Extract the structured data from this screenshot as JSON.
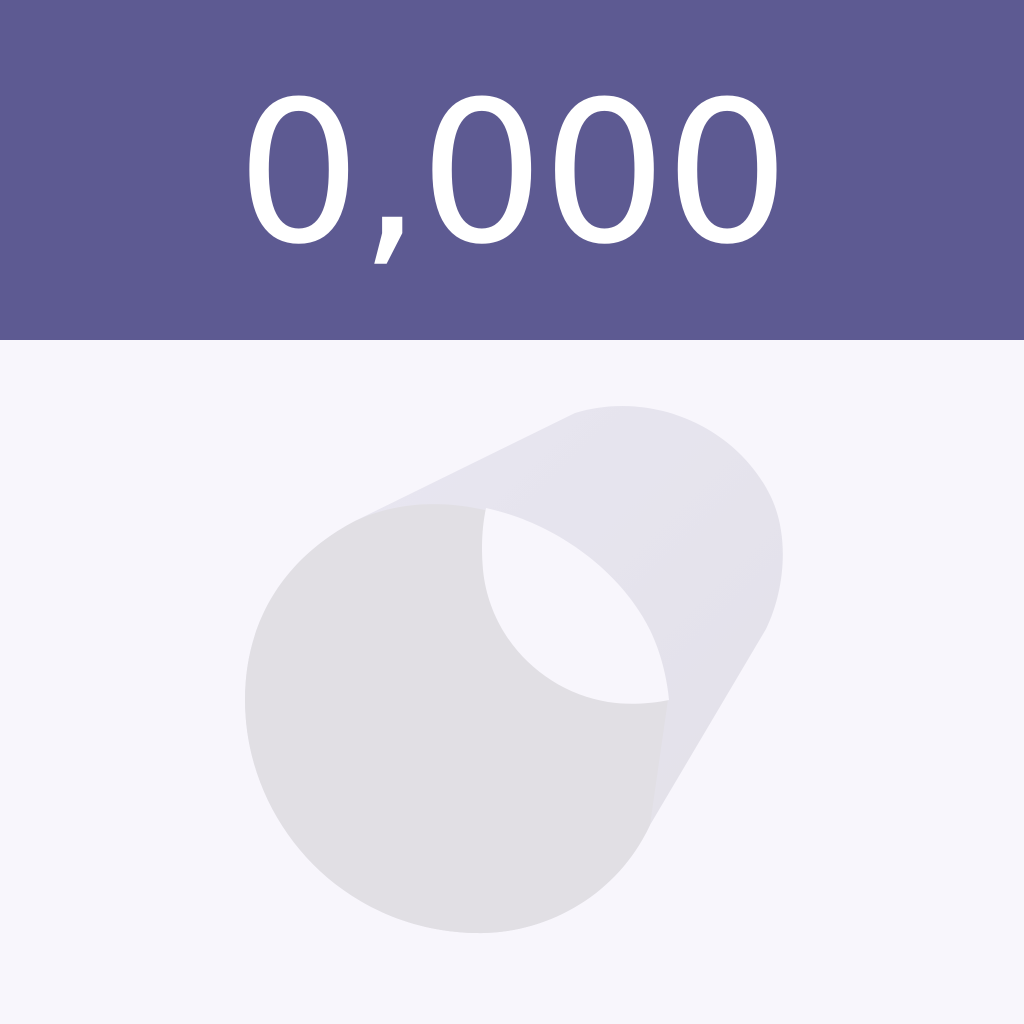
{
  "header": {
    "counter_value": "0,000"
  },
  "colors": {
    "header_background": "#5d5a92",
    "header_text": "#ffffff",
    "canvas_background": "#f8f6fc",
    "cup_body": "#e1dfe4",
    "cup_side": "#e7e5ee",
    "cup_opening": "#f8f6fc"
  },
  "canvas": {
    "object_icon": "cup-icon"
  }
}
